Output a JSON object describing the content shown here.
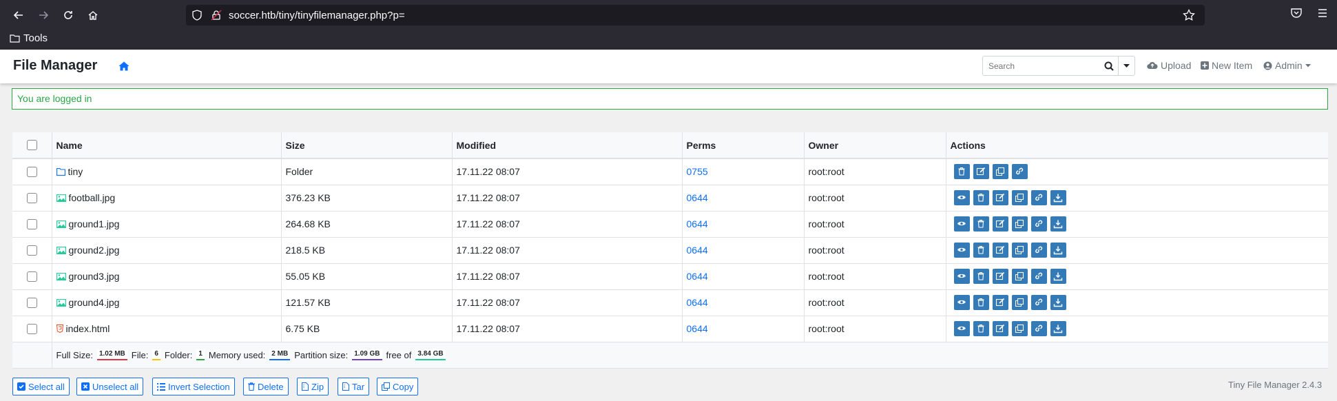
{
  "browser": {
    "url": "soccer.htb/tiny/tinyfilemanager.php?p=",
    "bookmark": "Tools"
  },
  "app": {
    "brand": "File Manager",
    "search_placeholder": "Search",
    "upload": "Upload",
    "new_item": "New Item",
    "admin": "Admin"
  },
  "alert": "You are logged in",
  "table": {
    "headers": [
      "Name",
      "Size",
      "Modified",
      "Perms",
      "Owner",
      "Actions"
    ],
    "rows": [
      {
        "name": "tiny",
        "type": "folder",
        "size": "Folder",
        "modified": "17.11.22 08:07",
        "perms": "0755",
        "owner": "root:root"
      },
      {
        "name": "football.jpg",
        "type": "image",
        "size": "376.23 KB",
        "modified": "17.11.22 08:07",
        "perms": "0644",
        "owner": "root:root"
      },
      {
        "name": "ground1.jpg",
        "type": "image",
        "size": "264.68 KB",
        "modified": "17.11.22 08:07",
        "perms": "0644",
        "owner": "root:root"
      },
      {
        "name": "ground2.jpg",
        "type": "image",
        "size": "218.5 KB",
        "modified": "17.11.22 08:07",
        "perms": "0644",
        "owner": "root:root"
      },
      {
        "name": "ground3.jpg",
        "type": "image",
        "size": "55.05 KB",
        "modified": "17.11.22 08:07",
        "perms": "0644",
        "owner": "root:root"
      },
      {
        "name": "ground4.jpg",
        "type": "image",
        "size": "121.57 KB",
        "modified": "17.11.22 08:07",
        "perms": "0644",
        "owner": "root:root"
      },
      {
        "name": "index.html",
        "type": "html",
        "size": "6.75 KB",
        "modified": "17.11.22 08:07",
        "perms": "0644",
        "owner": "root:root"
      }
    ]
  },
  "stats": {
    "full_size_label": "Full Size:",
    "full_size": "1.02 MB",
    "file_label": "File:",
    "file": "6",
    "folder_label": "Folder:",
    "folder": "1",
    "memory_label": "Memory used:",
    "memory": "2 MB",
    "partition_label": "Partition size:",
    "partition": "1.09 GB",
    "free_label": "free of",
    "free": "3.84 GB"
  },
  "buttons": {
    "select_all": "Select all",
    "unselect_all": "Unselect all",
    "invert": "Invert Selection",
    "delete": "Delete",
    "zip": "Zip",
    "tar": "Tar",
    "copy": "Copy"
  },
  "version": "Tiny File Manager 2.4.3",
  "colors": {
    "accent": "#337ab7",
    "link": "#0d6efd",
    "success": "#28a745"
  }
}
